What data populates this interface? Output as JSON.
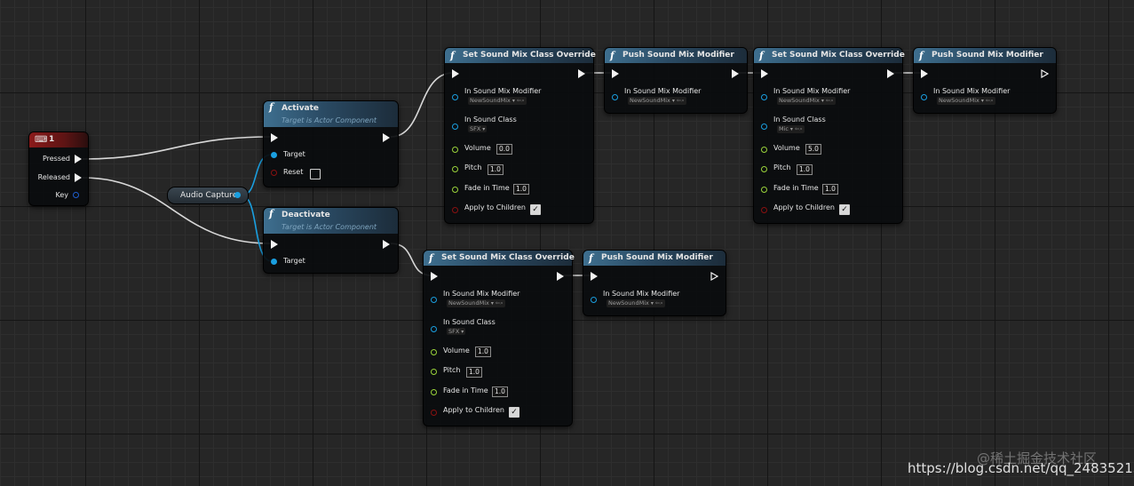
{
  "key_event": {
    "title": "1",
    "pins": {
      "pressed": "Pressed",
      "released": "Released",
      "key": "Key"
    }
  },
  "audio_capture": {
    "label": "Audio Capture"
  },
  "activate": {
    "title": "Activate",
    "subtitle": "Target is Actor Component",
    "target": "Target",
    "reset": "Reset"
  },
  "deactivate": {
    "title": "Deactivate",
    "subtitle": "Target is Actor Component",
    "target": "Target"
  },
  "set_override_1": {
    "title": "Set Sound Mix Class Override",
    "in_mix_label": "In Sound Mix Modifier",
    "in_mix_value": "NewSoundMix",
    "in_class_label": "In Sound Class",
    "in_class_value": "SFX",
    "volume_label": "Volume",
    "volume": "0.0",
    "pitch_label": "Pitch",
    "pitch": "1.0",
    "fade_label": "Fade in Time",
    "fade": "1.0",
    "apply_label": "Apply to Children",
    "apply_checked": true
  },
  "push_1": {
    "title": "Push Sound Mix Modifier",
    "in_mix_label": "In Sound Mix Modifier",
    "in_mix_value": "NewSoundMix"
  },
  "set_override_2": {
    "title": "Set Sound Mix Class Override",
    "in_mix_label": "In Sound Mix Modifier",
    "in_mix_value": "NewSoundMix",
    "in_class_label": "In Sound Class",
    "in_class_value": "Mic",
    "volume_label": "Volume",
    "volume": "5.0",
    "pitch_label": "Pitch",
    "pitch": "1.0",
    "fade_label": "Fade in Time",
    "fade": "1.0",
    "apply_label": "Apply to Children",
    "apply_checked": true
  },
  "push_2": {
    "title": "Push Sound Mix Modifier",
    "in_mix_label": "In Sound Mix Modifier",
    "in_mix_value": "NewSoundMix"
  },
  "set_override_3": {
    "title": "Set Sound Mix Class Override",
    "in_mix_label": "In Sound Mix Modifier",
    "in_mix_value": "NewSoundMix",
    "in_class_label": "In Sound Class",
    "in_class_value": "SFX",
    "volume_label": "Volume",
    "volume": "1.0",
    "pitch_label": "Pitch",
    "pitch": "1.0",
    "fade_label": "Fade in Time",
    "fade": "1.0",
    "apply_label": "Apply to Children",
    "apply_checked": true
  },
  "push_3": {
    "title": "Push Sound Mix Modifier",
    "in_mix_label": "In Sound Mix Modifier",
    "in_mix_value": "NewSoundMix"
  },
  "watermark": {
    "site": "@稀土掘金技术社区",
    "url": "https://blog.csdn.net/qq_24835213"
  },
  "colors": {
    "exec": "#f2f2f2",
    "object_pin": "#1a9fe0",
    "float_pin": "#9ad33a",
    "bool_pin": "#8a1010",
    "function_header": "#3e6f8f",
    "event_header": "#8b1a1a"
  }
}
